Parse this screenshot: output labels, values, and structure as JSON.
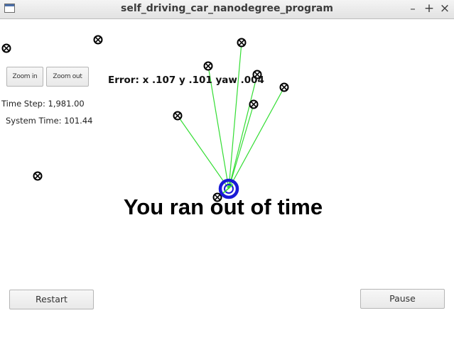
{
  "window": {
    "title": "self_driving_car_nanodegree_program",
    "minimize_glyph": "–",
    "maximize_glyph": "+",
    "close_glyph": "×",
    "app_icon": "window-icon"
  },
  "controls": {
    "zoom_in_label": "Zoom in",
    "zoom_out_label": "Zoom out",
    "restart_label": "Restart",
    "pause_label": "Pause"
  },
  "stats": {
    "time_step": "Time Step: 1,981.00",
    "system_time": "System Time: 101.44"
  },
  "simulation": {
    "error_text": "Error: x .107 y .101 yaw .004",
    "status_message": "You ran out of time",
    "landmark_icon": "landmark-marker-icon",
    "vehicle_icon": "vehicle-marker-icon",
    "colors": {
      "observation_line": "#33dd33",
      "vehicle": "#1a1ad6",
      "landmark": "#000000",
      "background": "#ffffff"
    }
  }
}
